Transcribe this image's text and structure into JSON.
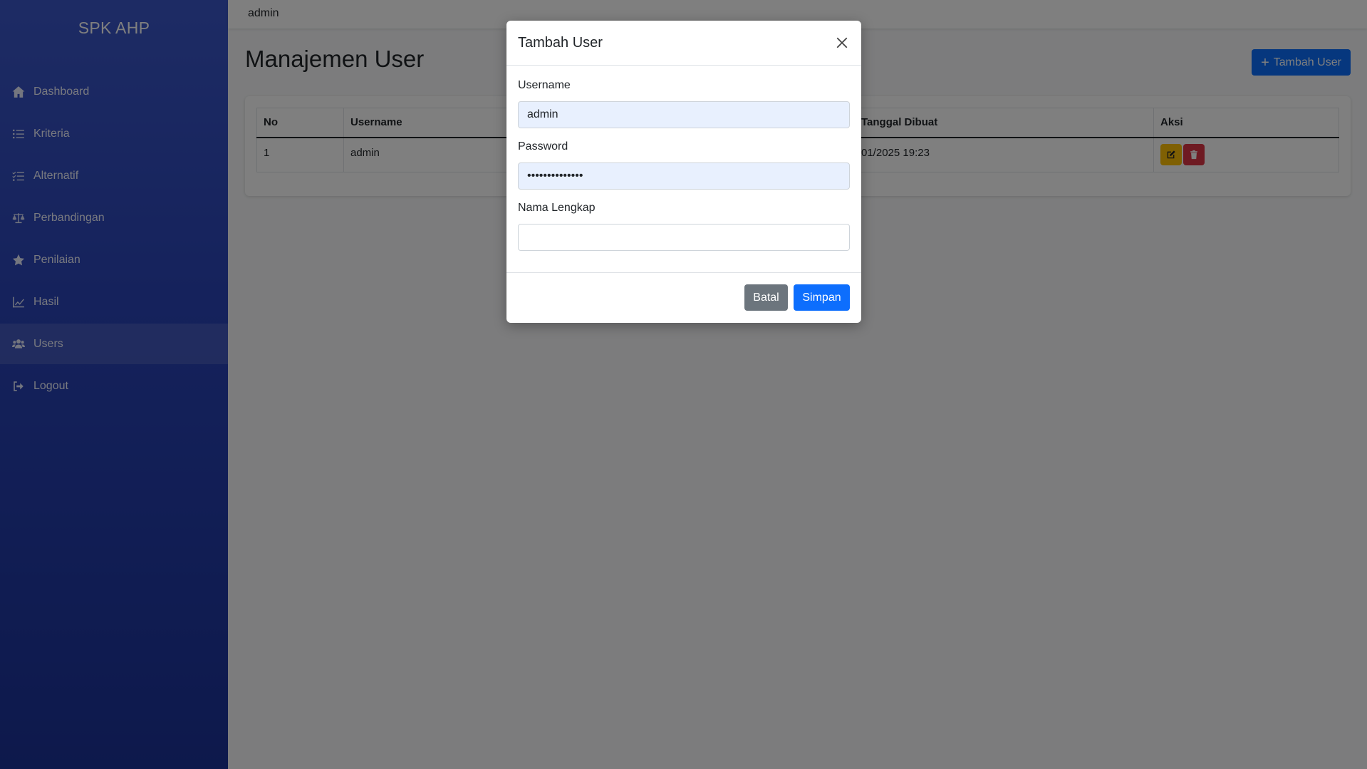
{
  "sidebar": {
    "brand": "SPK AHP",
    "items": [
      {
        "label": "Dashboard",
        "icon": "home-icon"
      },
      {
        "label": "Kriteria",
        "icon": "list-icon"
      },
      {
        "label": "Alternatif",
        "icon": "list-check-icon"
      },
      {
        "label": "Perbandingan",
        "icon": "balance-scale-icon"
      },
      {
        "label": "Penilaian",
        "icon": "star-icon"
      },
      {
        "label": "Hasil",
        "icon": "chart-icon"
      },
      {
        "label": "Users",
        "icon": "users-icon",
        "active": true
      },
      {
        "label": "Logout",
        "icon": "logout-icon"
      }
    ]
  },
  "topbar": {
    "user": "admin"
  },
  "main": {
    "title": "Manajemen User",
    "add_button": "Tambah User",
    "table": {
      "headers": [
        "No",
        "Username",
        "Tanggal Dibuat",
        "Aksi"
      ],
      "rows": [
        {
          "no": "1",
          "username": "admin",
          "created": "01/2025 19:23"
        }
      ]
    }
  },
  "modal": {
    "title": "Tambah User",
    "fields": {
      "username": {
        "label": "Username",
        "value": "admin"
      },
      "password": {
        "label": "Password",
        "value": "••••••••••••••"
      },
      "fullname": {
        "label": "Nama Lengkap",
        "value": ""
      }
    },
    "cancel": "Batal",
    "save": "Simpan"
  },
  "colors": {
    "primary": "#0d6efd",
    "secondary": "#6c757d",
    "warning": "#ffc107",
    "danger": "#dc3545",
    "sidebar": "#2a44b8"
  }
}
